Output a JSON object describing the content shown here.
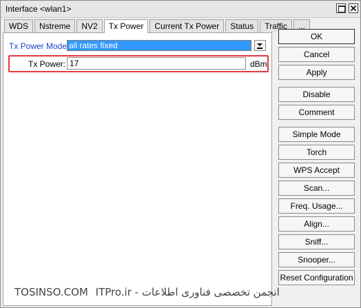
{
  "window": {
    "title": "Interface <wlan1>"
  },
  "tabs": [
    "WDS",
    "Nstreme",
    "NV2",
    "Tx Power",
    "Current Tx Power",
    "Status",
    "Traffic",
    "..."
  ],
  "form": {
    "tx_power_mode_label": "Tx Power Mode:",
    "tx_power_mode_value": "all rates fixed",
    "tx_power_label": "Tx Power:",
    "tx_power_value": "17",
    "tx_power_unit": "dBm"
  },
  "buttons": {
    "ok": "OK",
    "cancel": "Cancel",
    "apply": "Apply",
    "disable": "Disable",
    "comment": "Comment",
    "simple_mode": "Simple Mode",
    "torch": "Torch",
    "wps_accept": "WPS Accept",
    "scan": "Scan...",
    "freq_usage": "Freq. Usage...",
    "align": "Align...",
    "sniff": "Sniff...",
    "snooper": "Snooper...",
    "reset_configuration": "Reset Configuration"
  },
  "watermark": {
    "left": "TOSINSO.COM",
    "right": "ITPro.ir - انجمن تخصصی فناوری اطلاعات"
  },
  "colors": {
    "highlight": "#e03a3a",
    "label_blue": "#1a3fc8",
    "select_bg": "#3399ff"
  }
}
